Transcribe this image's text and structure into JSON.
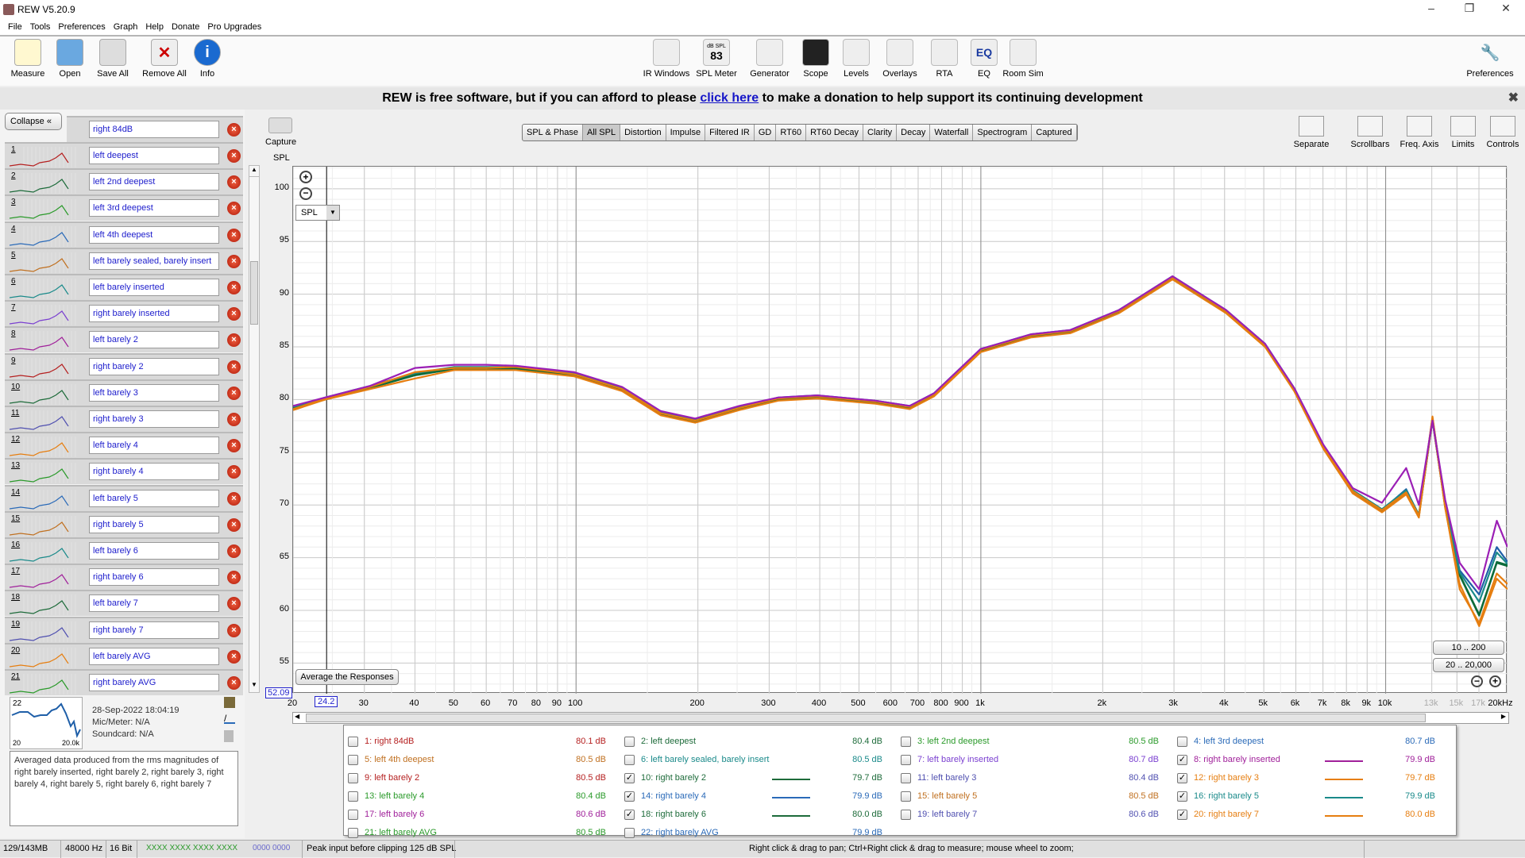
{
  "window": {
    "title": "REW V5.20.9",
    "minimize": "–",
    "restore": "❐",
    "close": "✕"
  },
  "menu": [
    "File",
    "Tools",
    "Preferences",
    "Graph",
    "Help",
    "Donate",
    "Pro Upgrades"
  ],
  "toolbar_left": [
    {
      "label": "Measure",
      "icon": "measure-icon"
    },
    {
      "label": "Open",
      "icon": "folder-icon"
    },
    {
      "label": "Save All",
      "icon": "save-icon"
    },
    {
      "label": "Remove All",
      "icon": "remove-icon"
    },
    {
      "label": "Info",
      "icon": "info-icon"
    }
  ],
  "toolbar_center": [
    {
      "label": "IR Windows",
      "icon": "ir-windows-icon"
    },
    {
      "label": "SPL Meter",
      "icon": "spl-meter-icon",
      "badge": "83",
      "badge_top": "dB SPL"
    },
    {
      "label": "Generator",
      "icon": "generator-icon"
    },
    {
      "label": "Scope",
      "icon": "scope-icon"
    },
    {
      "label": "Levels",
      "icon": "levels-icon"
    },
    {
      "label": "Overlays",
      "icon": "overlays-icon"
    },
    {
      "label": "RTA",
      "icon": "rta-icon"
    },
    {
      "label": "EQ",
      "icon": "eq-icon"
    },
    {
      "label": "Room Sim",
      "icon": "room-sim-icon"
    }
  ],
  "toolbar_right": {
    "label": "Preferences",
    "icon": "wrench-icon"
  },
  "banner": {
    "before": "REW is free software, but if you can afford to please ",
    "link": "click here",
    "after": " to make a donation to help support its continuing development",
    "close": "✖"
  },
  "left_panel": {
    "collapse": "Collapse",
    "top_item": "right 84dB",
    "rows": [
      {
        "n": "1",
        "name": "left deepest",
        "color": "#b52020"
      },
      {
        "n": "2",
        "name": "left 2nd deepest",
        "color": "#1d6b3a"
      },
      {
        "n": "3",
        "name": "left 3rd deepest",
        "color": "#2a9a2a"
      },
      {
        "n": "4",
        "name": "left 4th deepest",
        "color": "#2a6ab8"
      },
      {
        "n": "5",
        "name": "left barely sealed, barely insert",
        "color": "#c07020"
      },
      {
        "n": "6",
        "name": "left barely inserted",
        "color": "#1a8a8a"
      },
      {
        "n": "7",
        "name": "right barely inserted",
        "color": "#7a3fd0"
      },
      {
        "n": "8",
        "name": "left barely 2",
        "color": "#a0209a"
      },
      {
        "n": "9",
        "name": "right barely 2",
        "color": "#b52020"
      },
      {
        "n": "10",
        "name": "left barely 3",
        "color": "#1d6b3a"
      },
      {
        "n": "11",
        "name": "right barely 3",
        "color": "#5050b0"
      },
      {
        "n": "12",
        "name": "left barely 4",
        "color": "#e67e10"
      },
      {
        "n": "13",
        "name": "right barely 4",
        "color": "#2a9a2a"
      },
      {
        "n": "14",
        "name": "left barely 5",
        "color": "#2a6ab8"
      },
      {
        "n": "15",
        "name": "right barely 5",
        "color": "#c07020"
      },
      {
        "n": "16",
        "name": "left barely 6",
        "color": "#1a8a8a"
      },
      {
        "n": "17",
        "name": "right barely 6",
        "color": "#a0209a"
      },
      {
        "n": "18",
        "name": "left barely 7",
        "color": "#1d6b3a"
      },
      {
        "n": "19",
        "name": "right barely 7",
        "color": "#5050b0"
      },
      {
        "n": "20",
        "name": "left barely AVG",
        "color": "#e67e10"
      },
      {
        "n": "21",
        "name": "right barely AVG",
        "color": "#2a9a2a"
      }
    ],
    "selected": {
      "n": "22",
      "range_low": "20",
      "range_high": "20.0k",
      "date": "28-Sep-2022 18:04:19",
      "mic": "Mic/Meter: N/A",
      "soundcard": "Soundcard: N/A",
      "notes": "Averaged data produced from the rms magnitudes of right barely inserted, right barely 2, right barely 3, right barely 4, right barely 5, right barely 6, right barely 7"
    }
  },
  "graph": {
    "capture": "Capture",
    "tabs": [
      "SPL & Phase",
      "All SPL",
      "Distortion",
      "Impulse",
      "Filtered IR",
      "GD",
      "RT60",
      "RT60 Decay",
      "Clarity",
      "Decay",
      "Waterfall",
      "Spectrogram",
      "Captured"
    ],
    "active_tab": "All SPL",
    "right_tools": [
      {
        "label": "Separate",
        "icon": "separate-icon"
      },
      {
        "label": "Scrollbars",
        "icon": "scrollbars-icon"
      },
      {
        "label": "Freq. Axis",
        "icon": "freq-axis-icon"
      },
      {
        "label": "Limits",
        "icon": "limits-icon"
      },
      {
        "label": "Controls",
        "icon": "gear-icon"
      }
    ],
    "y_select": "SPL",
    "average_button": "Average the Responses",
    "range_buttons": [
      "10 .. 200",
      "20 .. 20,000"
    ],
    "y_readout": "52.09",
    "x_readout": "24.2",
    "hint": "Right click & drag to pan; Ctrl+Right click & drag to measure; mouse wheel to zoom;"
  },
  "chart_data": {
    "type": "line",
    "ylabel": "SPL",
    "xscale": "log",
    "xlim": [
      20,
      20000
    ],
    "ylim": [
      52.09,
      102.1
    ],
    "grid": true,
    "yticks": [
      55,
      60,
      65,
      70,
      75,
      80,
      85,
      90,
      95,
      100
    ],
    "xticks": [
      {
        "v": 20,
        "l": "20"
      },
      {
        "v": 30,
        "l": "30"
      },
      {
        "v": 40,
        "l": "40"
      },
      {
        "v": 50,
        "l": "50"
      },
      {
        "v": 60,
        "l": "60"
      },
      {
        "v": 70,
        "l": "70"
      },
      {
        "v": 80,
        "l": "80"
      },
      {
        "v": 90,
        "l": "90"
      },
      {
        "v": 100,
        "l": "100"
      },
      {
        "v": 200,
        "l": "200"
      },
      {
        "v": 300,
        "l": "300"
      },
      {
        "v": 400,
        "l": "400"
      },
      {
        "v": 500,
        "l": "500"
      },
      {
        "v": 600,
        "l": "600"
      },
      {
        "v": 700,
        "l": "700"
      },
      {
        "v": 800,
        "l": "800"
      },
      {
        "v": 900,
        "l": "900"
      },
      {
        "v": 1000,
        "l": "1k"
      },
      {
        "v": 2000,
        "l": "2k"
      },
      {
        "v": 3000,
        "l": "3k"
      },
      {
        "v": 4000,
        "l": "4k"
      },
      {
        "v": 5000,
        "l": "5k"
      },
      {
        "v": 6000,
        "l": "6k"
      },
      {
        "v": 7000,
        "l": "7k"
      },
      {
        "v": 8000,
        "l": "8k"
      },
      {
        "v": 9000,
        "l": "9k"
      },
      {
        "v": 10000,
        "l": "10k"
      },
      {
        "v": 13000,
        "l": "13k"
      },
      {
        "v": 15000,
        "l": "15k"
      },
      {
        "v": 17000,
        "l": "17k"
      },
      {
        "v": 20000,
        "l": "20kHz"
      }
    ],
    "x": [
      20,
      24,
      31,
      40,
      50,
      60,
      71,
      99,
      130,
      162,
      197,
      253,
      316,
      394,
      549,
      667,
      766,
      999,
      1332,
      1663,
      2194,
      2975,
      4034,
      5036,
      5944,
      7020,
      8290,
      9790,
      11240,
      12080,
      13050,
      14030,
      15240,
      17020,
      18820,
      20000
    ],
    "series": [
      {
        "name": "14: right barely 4",
        "color": "#1f5fa8",
        "values": [
          79.3,
          80.1,
          81.2,
          82.4,
          83.0,
          83.0,
          83.0,
          82.4,
          81.0,
          78.8,
          78.0,
          79.2,
          80.1,
          80.3,
          79.8,
          79.3,
          80.5,
          84.7,
          86.1,
          86.5,
          88.4,
          91.6,
          88.4,
          85.2,
          81.0,
          75.5,
          71.3,
          69.5,
          71.5,
          69.0,
          78.0,
          69.9,
          63.8,
          61.5,
          66.0,
          64.6
        ]
      },
      {
        "name": "10: right barely 2",
        "color": "#0e6b3a",
        "values": [
          79.2,
          80.0,
          81.1,
          82.3,
          82.9,
          82.9,
          82.9,
          82.3,
          80.9,
          78.6,
          77.9,
          79.1,
          80.0,
          80.2,
          79.7,
          79.2,
          80.4,
          84.6,
          86.0,
          86.4,
          88.3,
          91.5,
          88.3,
          85.1,
          80.9,
          75.4,
          71.2,
          69.4,
          71.2,
          68.9,
          78.1,
          69.8,
          63.3,
          59.5,
          64.5,
          64.2
        ]
      },
      {
        "name": "18: right barely 6",
        "color": "#0e6b3a",
        "values": [
          79.2,
          80.1,
          81.2,
          82.4,
          83.0,
          83.0,
          83.0,
          82.4,
          81.0,
          78.7,
          78.0,
          79.2,
          80.1,
          80.3,
          79.8,
          79.3,
          80.5,
          84.7,
          86.1,
          86.5,
          88.4,
          91.6,
          88.4,
          85.2,
          81.0,
          75.5,
          71.3,
          69.5,
          71.3,
          69.0,
          78.2,
          69.9,
          63.4,
          59.6,
          64.6,
          64.3
        ]
      },
      {
        "name": "16: right barely 5",
        "color": "#1a8a8a",
        "values": [
          79.3,
          80.2,
          81.3,
          82.5,
          83.1,
          83.1,
          83.1,
          82.5,
          81.1,
          78.8,
          78.1,
          79.3,
          80.2,
          80.4,
          79.9,
          79.4,
          80.6,
          84.8,
          86.2,
          86.6,
          88.5,
          91.7,
          88.5,
          85.3,
          81.1,
          75.6,
          71.4,
          69.6,
          71.4,
          69.1,
          78.3,
          70.0,
          63.6,
          60.8,
          65.5,
          64.4
        ]
      },
      {
        "name": "12: right barely 3",
        "color": "#e67e10",
        "values": [
          79.0,
          80.0,
          81.0,
          82.0,
          82.8,
          82.8,
          82.8,
          82.2,
          80.8,
          78.5,
          77.8,
          79.0,
          79.9,
          80.1,
          79.6,
          79.1,
          80.3,
          84.5,
          85.9,
          86.3,
          88.2,
          91.4,
          88.2,
          85.0,
          80.8,
          75.3,
          71.1,
          69.3,
          71.0,
          68.8,
          78.4,
          69.7,
          62.5,
          58.5,
          63.0,
          62.0
        ]
      },
      {
        "name": "20: right barely 7",
        "color": "#e67e10",
        "values": [
          79.1,
          80.1,
          81.2,
          82.6,
          83.0,
          83.0,
          83.1,
          82.4,
          81.0,
          78.7,
          78.0,
          79.2,
          80.1,
          80.3,
          79.8,
          79.3,
          80.5,
          84.7,
          86.1,
          86.5,
          88.4,
          91.6,
          88.4,
          85.2,
          81.0,
          75.5,
          71.3,
          69.5,
          71.2,
          69.0,
          78.1,
          69.8,
          62.0,
          58.8,
          63.5,
          62.5
        ]
      },
      {
        "name": "8: right barely inserted",
        "color": "#9b1fb5",
        "values": [
          79.4,
          80.2,
          81.3,
          83.0,
          83.3,
          83.3,
          83.2,
          82.6,
          81.2,
          78.9,
          78.2,
          79.4,
          80.2,
          80.4,
          79.9,
          79.4,
          80.6,
          84.8,
          86.2,
          86.6,
          88.5,
          91.7,
          88.5,
          85.3,
          81.1,
          75.7,
          71.6,
          70.2,
          73.5,
          70.0,
          78.0,
          70.5,
          64.5,
          62.0,
          68.5,
          66.0
        ]
      }
    ]
  },
  "legend": [
    {
      "label": "1: right 84dB",
      "value": "80.1 dB",
      "color": "#b52020",
      "checked": false
    },
    {
      "label": "2: left deepest",
      "value": "80.4 dB",
      "color": "#1d6b3a",
      "checked": false
    },
    {
      "label": "3: left 2nd deepest",
      "value": "80.5 dB",
      "color": "#2a9a2a",
      "checked": false
    },
    {
      "label": "4: left 3rd deepest",
      "value": "80.7 dB",
      "color": "#2a6ab8",
      "checked": false
    },
    {
      "label": "5: left 4th deepest",
      "value": "80.5 dB",
      "color": "#c07020",
      "checked": false
    },
    {
      "label": "6: left barely sealed, barely insert",
      "value": "80.5 dB",
      "color": "#1a8a8a",
      "checked": false
    },
    {
      "label": "7: left barely inserted",
      "value": "80.7 dB",
      "color": "#7a3fd0",
      "checked": false
    },
    {
      "label": "8: right barely inserted",
      "value": "79.9 dB",
      "color": "#a0209a",
      "checked": true
    },
    {
      "label": "9: left barely 2",
      "value": "80.5 dB",
      "color": "#b52020",
      "checked": false
    },
    {
      "label": "10: right barely 2",
      "value": "79.7 dB",
      "color": "#1d6b3a",
      "checked": true
    },
    {
      "label": "11: left barely 3",
      "value": "80.4 dB",
      "color": "#5050b0",
      "checked": false
    },
    {
      "label": "12: right barely 3",
      "value": "79.7 dB",
      "color": "#e67e10",
      "checked": true
    },
    {
      "label": "13: left barely 4",
      "value": "80.4 dB",
      "color": "#2a9a2a",
      "checked": false
    },
    {
      "label": "14: right barely 4",
      "value": "79.9 dB",
      "color": "#2a6ab8",
      "checked": true
    },
    {
      "label": "15: left barely 5",
      "value": "80.5 dB",
      "color": "#c07020",
      "checked": false
    },
    {
      "label": "16: right barely 5",
      "value": "79.9 dB",
      "color": "#1a8a8a",
      "checked": true
    },
    {
      "label": "17: left barely 6",
      "value": "80.6 dB",
      "color": "#a0209a",
      "checked": false
    },
    {
      "label": "18: right barely 6",
      "value": "80.0 dB",
      "color": "#1d6b3a",
      "checked": true
    },
    {
      "label": "19: left barely 7",
      "value": "80.6 dB",
      "color": "#5050b0",
      "checked": false
    },
    {
      "label": "20: right barely 7",
      "value": "80.0 dB",
      "color": "#e67e10",
      "checked": true
    },
    {
      "label": "21: left barely AVG",
      "value": "80.5 dB",
      "color": "#2a9a2a",
      "checked": false
    },
    {
      "label": "22: right barely AVG",
      "value": "79.9 dB",
      "color": "#2a6ab8",
      "checked": false
    }
  ],
  "status": {
    "memory": "129/143MB",
    "rate": "48000 Hz",
    "bits": "16 Bit",
    "in_levels": "XXXX XXXX  XXXX XXXX",
    "out_levels": "0000 0000",
    "peak": "Peak input before clipping 125 dB SPL"
  }
}
